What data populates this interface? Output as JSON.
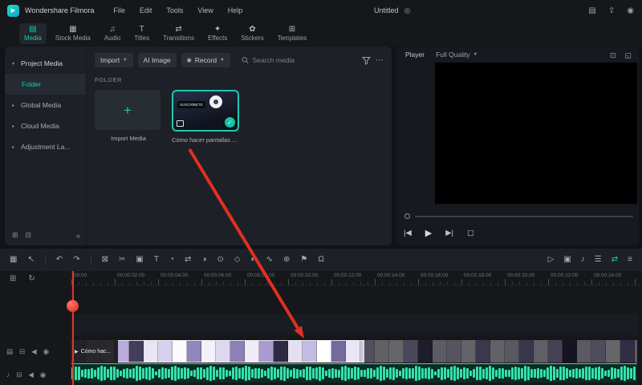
{
  "colors": {
    "accent": "#1EC8B0",
    "arrow": "#E03022",
    "waveform": "#31E2A9"
  },
  "titlebar": {
    "app_name": "Wondershare Filmora",
    "menus": [
      "File",
      "Edit",
      "Tools",
      "View",
      "Help"
    ],
    "project_title": "Untitled",
    "sync_glyph": "◎",
    "right_icons": [
      {
        "name": "workspace-layout-icon",
        "glyph": "▤"
      },
      {
        "name": "export-icon",
        "glyph": "⇪"
      },
      {
        "name": "account-icon",
        "glyph": "◉"
      }
    ]
  },
  "tabs": [
    {
      "label": "Media",
      "glyph": "▤",
      "active": true
    },
    {
      "label": "Stock Media",
      "glyph": "▦"
    },
    {
      "label": "Audio",
      "glyph": "♫"
    },
    {
      "label": "Titles",
      "glyph": "T"
    },
    {
      "label": "Transitions",
      "glyph": "⇄"
    },
    {
      "label": "Effects",
      "glyph": "✦"
    },
    {
      "label": "Stickers",
      "glyph": "✿"
    },
    {
      "label": "Templates",
      "glyph": "⊞"
    }
  ],
  "sidebar": {
    "items": [
      {
        "label": "Project Media",
        "chevron": "▾"
      },
      {
        "label": "Folder",
        "selected": true
      },
      {
        "label": "Global Media",
        "chevron": "▸"
      },
      {
        "label": "Cloud Media",
        "chevron": "▸"
      },
      {
        "label": "Adjustment La...",
        "chevron": "▸"
      }
    ],
    "bottom": [
      {
        "name": "new-folder-icon",
        "glyph": "⊞"
      },
      {
        "name": "delete-folder-icon",
        "glyph": "⊟"
      },
      {
        "name": "collapse-panel-icon",
        "glyph": "«"
      }
    ]
  },
  "media_panel": {
    "import_button": "Import",
    "ai_image_button": "AI Image",
    "record_button": "Record",
    "record_glyph": "◉",
    "caret": "▼",
    "more_glyph": "⋯",
    "search_placeholder": "Search media",
    "section_label": "FOLDER",
    "import_tile_label": "Import Media",
    "plus_glyph": "+",
    "clip_tile_label": "Cómo hacer pantallas ...",
    "clip_badge_text": "SUSCRÍBETE",
    "check_glyph": "✓"
  },
  "player": {
    "label": "Player",
    "quality": "Full Quality",
    "caret": "▼",
    "icons": [
      {
        "name": "snapshot-icon",
        "glyph": "⊡"
      },
      {
        "name": "fullscreen-icon",
        "glyph": "◱"
      }
    ],
    "transport": {
      "prev": "|◀",
      "play": "▶",
      "next": "▶|",
      "stop": "▢"
    }
  },
  "toolbar": {
    "left": [
      {
        "name": "track-manage-icon",
        "glyph": "▦"
      },
      {
        "name": "pointer-tool-icon",
        "glyph": "↖"
      },
      {
        "name": "undo-icon",
        "glyph": "↶"
      },
      {
        "name": "redo-icon",
        "glyph": "↷"
      },
      {
        "name": "delete-icon",
        "glyph": "⊠"
      },
      {
        "name": "split-icon",
        "glyph": "✂"
      },
      {
        "name": "crop-icon",
        "glyph": "▣"
      },
      {
        "name": "text-icon",
        "glyph": "T"
      },
      {
        "name": "speed-icon",
        "glyph": "◔"
      },
      {
        "name": "transition-icon",
        "glyph": "⇄"
      },
      {
        "name": "color-icon",
        "glyph": "◑"
      },
      {
        "name": "chroma-key-icon",
        "glyph": "⊙"
      },
      {
        "name": "keyframe-icon",
        "glyph": "◇"
      },
      {
        "name": "mask-icon",
        "glyph": "◐"
      },
      {
        "name": "motion-icon",
        "glyph": "∿"
      },
      {
        "name": "zoom-icon",
        "glyph": "⊕"
      },
      {
        "name": "marker-icon",
        "glyph": "⚑"
      },
      {
        "name": "snap-icon",
        "glyph": "Ω"
      }
    ],
    "right": [
      {
        "name": "render-preview-icon",
        "glyph": "▷"
      },
      {
        "name": "screen-record-icon",
        "glyph": "▣"
      },
      {
        "name": "voiceover-icon",
        "glyph": "♪"
      },
      {
        "name": "mixer-icon",
        "glyph": "☰"
      },
      {
        "name": "auto-ripple-icon",
        "glyph": "⇄",
        "active": true
      },
      {
        "name": "track-size-icon",
        "glyph": "≡"
      }
    ]
  },
  "timeline": {
    "header_icons": [
      {
        "name": "add-track-icon",
        "glyph": "⊞"
      },
      {
        "name": "loop-icon",
        "glyph": "↻"
      }
    ],
    "ruler_labels": [
      "00:00",
      "00:00:02:00",
      "00:00:04:00",
      "00:00:06:00",
      "00:00:08:00",
      "00:00:10:00",
      "00:00:12:00",
      "00:00:14:00",
      "00:00:16:00",
      "00:00:18:00",
      "00:00:20:00",
      "00:00:22:00",
      "00:00:24:00"
    ],
    "clip_label": "Cómo hac...",
    "clip_icon_glyph": "▶",
    "video_track_icons": [
      {
        "name": "clip-thumbnail-icon",
        "glyph": "▤"
      },
      {
        "name": "lock-track-icon",
        "glyph": "⊟"
      },
      {
        "name": "mute-track-icon",
        "glyph": "◀"
      },
      {
        "name": "hide-track-icon",
        "glyph": "◉"
      }
    ],
    "audio_track_icons": [
      {
        "name": "audio-track-icon",
        "glyph": "♪"
      },
      {
        "name": "lock-track-icon",
        "glyph": "⊟"
      },
      {
        "name": "mute-track-icon",
        "glyph": "◀"
      },
      {
        "name": "hide-track-icon",
        "glyph": "◉"
      }
    ],
    "filmstrip_colors": [
      "#cdc6e4",
      "#f1eef8",
      "#ffffff",
      "#b9abdc",
      "#433d5c",
      "#e9e5f4",
      "#d7d0ec",
      "#fbfaff",
      "#9185bd",
      "#f4f1fa",
      "#ded8ee",
      "#8d80b8",
      "#efecf7",
      "#a99bd0",
      "#2e2a44",
      "#e4e0f1",
      "#c4bbe2",
      "#ffffff",
      "#746aa0",
      "#eae6f5"
    ]
  }
}
